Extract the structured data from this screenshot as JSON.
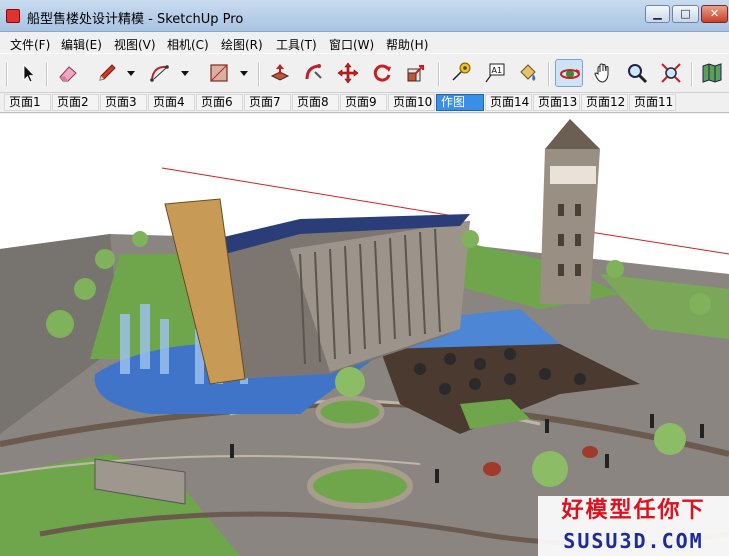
{
  "window": {
    "title": "船型售楼处设计精模 - SketchUp Pro",
    "minimize_glyph": "▁",
    "maximize_glyph": "□",
    "close_glyph": "✕"
  },
  "menu": {
    "items": [
      {
        "label": "文件(F)"
      },
      {
        "label": "编辑(E)"
      },
      {
        "label": "视图(V)"
      },
      {
        "label": "相机(C)"
      },
      {
        "label": "绘图(R)"
      },
      {
        "label": "工具(T)"
      },
      {
        "label": "窗口(W)"
      },
      {
        "label": "帮助(H)"
      }
    ]
  },
  "toolbar": {
    "tools": [
      {
        "name": "select-tool",
        "icon": "arrow-cursor-icon"
      },
      {
        "name": "eraser-tool",
        "icon": "eraser-icon"
      },
      {
        "name": "pencil-tool",
        "icon": "pencil-icon"
      },
      {
        "name": "arc-tool",
        "icon": "arc-icon"
      },
      {
        "name": "rectangle-tool",
        "icon": "rectangle-icon"
      },
      {
        "name": "push-pull-tool",
        "icon": "push-pull-icon"
      },
      {
        "name": "follow-me-tool",
        "icon": "follow-me-icon"
      },
      {
        "name": "move-tool",
        "icon": "move-icon"
      },
      {
        "name": "rotate-tool",
        "icon": "rotate-icon"
      },
      {
        "name": "scale-tool",
        "icon": "scale-icon"
      },
      {
        "name": "tape-measure-tool",
        "icon": "tape-measure-icon"
      },
      {
        "name": "text-tool",
        "icon": "text-label-icon"
      },
      {
        "name": "paint-bucket-tool",
        "icon": "paint-bucket-icon"
      },
      {
        "name": "orbit-tool",
        "icon": "orbit-icon"
      },
      {
        "name": "pan-tool",
        "icon": "hand-icon"
      },
      {
        "name": "zoom-tool",
        "icon": "magnifier-icon"
      },
      {
        "name": "zoom-extents-tool",
        "icon": "zoom-extents-icon"
      },
      {
        "name": "map-tool",
        "icon": "map-icon"
      }
    ],
    "text_tool_label": "A1",
    "active_tool": "orbit-tool"
  },
  "scenes": {
    "tabs": [
      {
        "label": "页面1"
      },
      {
        "label": "页面2"
      },
      {
        "label": "页面3"
      },
      {
        "label": "页面4"
      },
      {
        "label": "页面6"
      },
      {
        "label": "页面7"
      },
      {
        "label": "页面8"
      },
      {
        "label": "页面9"
      },
      {
        "label": "页面10"
      },
      {
        "label": "作图"
      },
      {
        "label": "页面14"
      },
      {
        "label": "页面13"
      },
      {
        "label": "页面12"
      },
      {
        "label": "页面11"
      }
    ],
    "active_tab": "作图"
  },
  "watermark": {
    "line1": "好模型任你下",
    "line2": "SUSU3D.COM"
  },
  "colors": {
    "active_scene": "#3b8ee8",
    "axis_red": "#d42020",
    "water": "#3f74c9",
    "grass": "#6fa64c",
    "pavement": "#8a8580",
    "watermark_red": "#e0111e",
    "watermark_blue": "#1b2a9c"
  }
}
